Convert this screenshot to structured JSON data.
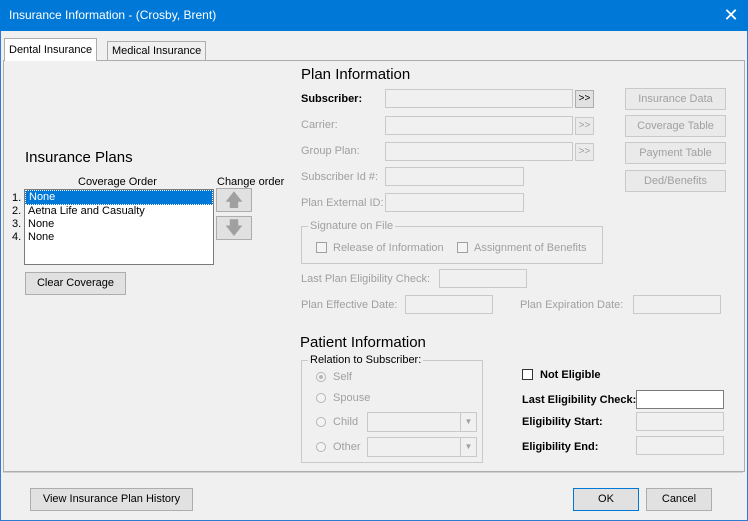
{
  "window": {
    "title": "Insurance Information - (Crosby, Brent)",
    "close_glyph": "✕"
  },
  "tabs": [
    {
      "label": "Dental Insurance"
    },
    {
      "label": "Medical Insurance"
    }
  ],
  "insurance_plans": {
    "heading": "Insurance Plans",
    "coverage_order_label": "Coverage Order",
    "change_order_label": "Change order",
    "items": [
      {
        "num": "1.",
        "name": "None"
      },
      {
        "num": "2.",
        "name": "Aetna Life and Casualty"
      },
      {
        "num": "3.",
        "name": "None"
      },
      {
        "num": "4.",
        "name": "None"
      }
    ],
    "up_glyph": "🡅",
    "down_glyph": "🡇",
    "clear_button": "Clear Coverage"
  },
  "plan_info": {
    "heading": "Plan Information",
    "subscriber_label": "Subscriber:",
    "carrier_label": "Carrier:",
    "group_plan_label": "Group Plan:",
    "subscriber_id_label": "Subscriber Id #:",
    "plan_external_id_label": "Plan External ID:",
    "browse_glyph": ">>",
    "signature_group": "Signature on File",
    "release_info": "Release of Information",
    "assignment_benefits": "Assignment of Benefits",
    "last_plan_elig_label": "Last Plan Eligibility Check:",
    "plan_effective_label": "Plan Effective Date:",
    "plan_expiration_label": "Plan Expiration Date:"
  },
  "side_buttons": {
    "insurance_data": "Insurance Data",
    "coverage_table": "Coverage Table",
    "payment_table": "Payment Table",
    "ded_benefits": "Ded/Benefits"
  },
  "patient_info": {
    "heading": "Patient Information",
    "relation_group": "Relation to Subscriber:",
    "self": "Self",
    "spouse": "Spouse",
    "child": "Child",
    "other": "Other",
    "not_eligible": "Not Eligible",
    "last_elig_label": "Last Eligibility Check:",
    "elig_start_label": "Eligibility Start:",
    "elig_end_label": "Eligibility End:"
  },
  "footer": {
    "history_button": "View Insurance Plan History",
    "ok_button": "OK",
    "cancel_button": "Cancel"
  }
}
